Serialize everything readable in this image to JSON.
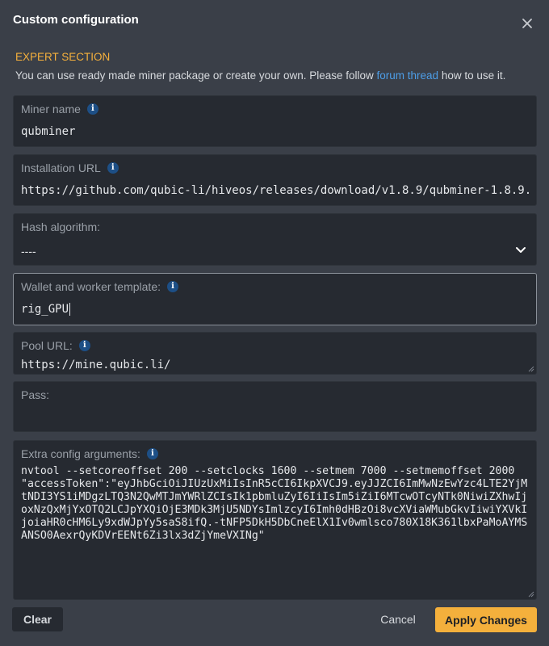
{
  "dialog": {
    "title": "Custom configuration",
    "expert_label": "EXPERT SECTION",
    "description_before": "You can use ready made miner package or create your own. Please follow ",
    "description_link": "forum thread",
    "description_after": " how to use it."
  },
  "fields": {
    "miner_name": {
      "label": "Miner name",
      "value": "qubminer"
    },
    "install_url": {
      "label": "Installation URL",
      "value": "https://github.com/qubic-li/hiveos/releases/download/v1.8.9/qubminer-1.8.9."
    },
    "hash_algorithm": {
      "label": "Hash algorithm:",
      "value": "----"
    },
    "wallet_template": {
      "label": "Wallet and worker template:",
      "value": "rig_GPU"
    },
    "pool_url": {
      "label": "Pool URL:",
      "value": "https://mine.qubic.li/"
    },
    "pass": {
      "label": "Pass:",
      "value": ""
    },
    "extra_config": {
      "label": "Extra config arguments:",
      "value": "nvtool --setcoreoffset 200 --setclocks 1600 --setmem 7000 --setmemoffset 2000\n\"accessToken\":\"eyJhbGciOiJIUzUxMiIsInR5cCI6IkpXVCJ9.eyJJZCI6ImMwNzEwYzc4LTE2YjMtNDI3YS1iMDgzLTQ3N2QwMTJmYWRlZCIsIk1pbmluZyI6IiIsIm5iZiI6MTcwOTcyNTk0NiwiZXhwIjoxNzQxMjYxOTQ2LCJpYXQiOjE3MDk3MjU5NDYsImlzcyI6Imh0dHBzOi8vcXViaWMubGkvIiwiYXVkIjoiaHR0cHM6Ly9xdWJpYy5saS8ifQ.-tNFP5DkH5DbCneElX1Iv0wmlsco780X18K361lbxPaMoAYMSANSO0AexrQyKDVrEENt6Zi3lx3dZjYmeVXINg\""
    }
  },
  "buttons": {
    "clear": "Clear",
    "cancel": "Cancel",
    "apply": "Apply Changes"
  },
  "colors": {
    "accent": "#f4b03c",
    "link": "#4d9ee8",
    "info_badge": "#1d4f86"
  },
  "icons": {
    "close": "close-icon",
    "info": "info-icon",
    "chevron": "chevron-down-icon"
  }
}
